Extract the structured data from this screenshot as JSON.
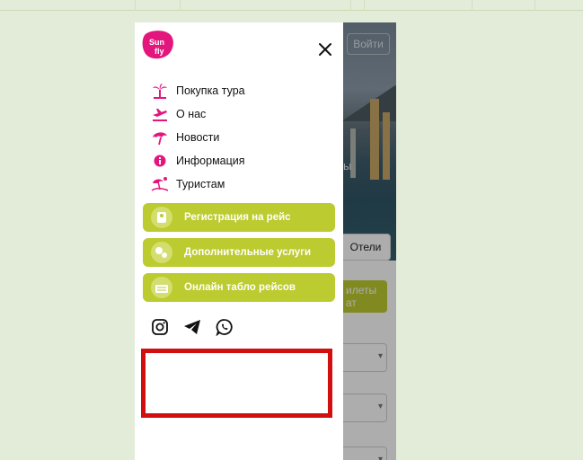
{
  "background": {
    "login_label": "Войти",
    "hero_text": "ы",
    "tab_label": "Отели",
    "cta_label": "илеты\nат"
  },
  "menu": {
    "nav": [
      {
        "label": "Покупка тура",
        "icon": "palm-tree-icon"
      },
      {
        "label": "О нас",
        "icon": "airplane-icon"
      },
      {
        "label": "Новости",
        "icon": "umbrella-icon"
      },
      {
        "label": "Информация",
        "icon": "info-icon"
      },
      {
        "label": "Туристам",
        "icon": "beach-icon"
      }
    ],
    "services": [
      {
        "label": "Регистрация на рейс",
        "icon": "checkin-icon"
      },
      {
        "label": "Дополнительные услуги",
        "icon": "services-icon"
      },
      {
        "label": "Онлайн табло рейсов",
        "icon": "board-icon"
      }
    ],
    "social": [
      "instagram-icon",
      "telegram-icon",
      "whatsapp-icon"
    ]
  },
  "colors": {
    "brand_pink": "#e3167d",
    "accent_green": "#bccb2f",
    "highlight_red": "#d20f0f"
  }
}
